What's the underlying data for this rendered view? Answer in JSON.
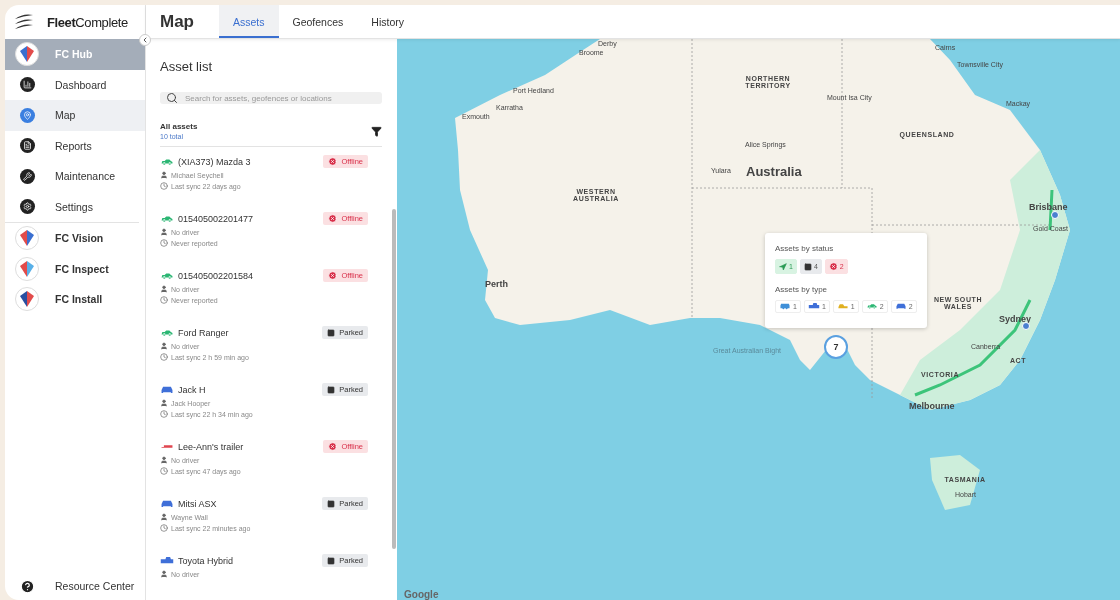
{
  "brand": {
    "name_bold": "Fleet",
    "name_rest": "Complete"
  },
  "sidebar": {
    "items": [
      {
        "kind": "app",
        "label": "FC Hub",
        "selected": true
      },
      {
        "kind": "nav",
        "label": "Dashboard",
        "selected": false
      },
      {
        "kind": "nav",
        "label": "Map",
        "selected": true
      },
      {
        "kind": "nav",
        "label": "Reports",
        "selected": false
      },
      {
        "kind": "nav",
        "label": "Maintenance",
        "selected": false
      },
      {
        "kind": "nav",
        "label": "Settings",
        "selected": false
      },
      {
        "kind": "app",
        "label": "FC Vision",
        "selected": false
      },
      {
        "kind": "app",
        "label": "FC Inspect",
        "selected": false
      },
      {
        "kind": "app",
        "label": "FC Install",
        "selected": false
      }
    ],
    "footer": "Resource Center"
  },
  "header": {
    "title": "Map",
    "tabs": [
      {
        "label": "Assets",
        "selected": true
      },
      {
        "label": "Geofences",
        "selected": false
      },
      {
        "label": "History",
        "selected": false
      }
    ]
  },
  "asset_list": {
    "title": "Asset list",
    "search": {
      "placeholder": "Search for assets, geofences or locations"
    },
    "group": "All assets",
    "total": "10 total",
    "assets": [
      {
        "name": "(XIA373) Mazda 3",
        "kind": "car",
        "color": "#2bb673",
        "status": {
          "kind": "offline",
          "label": "Offline"
        },
        "driver": "Michael Seychell",
        "sync": "Last sync 22 days ago"
      },
      {
        "name": "015405002201477",
        "kind": "car",
        "color": "#2bb673",
        "status": {
          "kind": "offline",
          "label": "Offline"
        },
        "driver": "No driver",
        "sync": "Never reported"
      },
      {
        "name": "015405002201584",
        "kind": "car",
        "color": "#2bb673",
        "status": {
          "kind": "offline",
          "label": "Offline"
        },
        "driver": "No driver",
        "sync": "Never reported"
      },
      {
        "name": "Ford Ranger",
        "kind": "car",
        "color": "#2bb673",
        "status": {
          "kind": "parked",
          "label": "Parked"
        },
        "driver": "No driver",
        "sync": "Last sync 2 h 59 min ago"
      },
      {
        "name": "Jack H",
        "kind": "suv",
        "color": "#3f6fd8",
        "status": {
          "kind": "parked",
          "label": "Parked"
        },
        "driver": "Jack Hooper",
        "sync": "Last sync 22 h 34 min ago"
      },
      {
        "name": "Lee-Ann's trailer",
        "kind": "trailer",
        "color": "#e0454f",
        "status": {
          "kind": "offline",
          "label": "Offline"
        },
        "driver": "No driver",
        "sync": "Last sync 47 days ago"
      },
      {
        "name": "Mitsi ASX",
        "kind": "suv",
        "color": "#3f6fd8",
        "status": {
          "kind": "parked",
          "label": "Parked"
        },
        "driver": "Wayne Wall",
        "sync": "Last sync 22 minutes ago"
      },
      {
        "name": "Toyota Hybrid",
        "kind": "pickup",
        "color": "#3f6fd8",
        "status": {
          "kind": "parked",
          "label": "Parked"
        },
        "driver": "No driver"
      }
    ]
  },
  "map": {
    "labels": [
      {
        "text": "Derby",
        "kind": "city"
      },
      {
        "text": "Broome",
        "kind": "city"
      },
      {
        "text": "Port Hedland",
        "kind": "city"
      },
      {
        "text": "Karratha",
        "kind": "city"
      },
      {
        "text": "Exmouth",
        "kind": "city"
      },
      {
        "text": "Cairns",
        "kind": "city"
      },
      {
        "text": "Townsville City",
        "kind": "city"
      },
      {
        "text": "Mackay",
        "kind": "city"
      },
      {
        "text": "NORTHERN TERRITORY",
        "kind": "region"
      },
      {
        "text": "Mount Isa City",
        "kind": "city"
      },
      {
        "text": "Alice Springs",
        "kind": "city"
      },
      {
        "text": "Yulara",
        "kind": "city"
      },
      {
        "text": "Australia",
        "kind": "country"
      },
      {
        "text": "QUEENSLAND",
        "kind": "region"
      },
      {
        "text": "WESTERN AUSTRALIA",
        "kind": "region"
      },
      {
        "text": "Perth",
        "kind": "major"
      },
      {
        "text": "Brisbane",
        "kind": "major"
      },
      {
        "text": "Gold Coast",
        "kind": "city"
      },
      {
        "text": "NEW SOUTH WALES",
        "kind": "region"
      },
      {
        "text": "Sydney",
        "kind": "major"
      },
      {
        "text": "Canberra",
        "kind": "city"
      },
      {
        "text": "ACT",
        "kind": "region"
      },
      {
        "text": "VICTORIA",
        "kind": "region"
      },
      {
        "text": "Melbourne",
        "kind": "major"
      },
      {
        "text": "TASMANIA",
        "kind": "region"
      },
      {
        "text": "Hobart",
        "kind": "city"
      },
      {
        "text": "Great Australian Bight",
        "kind": "water"
      }
    ],
    "cluster": "7",
    "popup": {
      "status_title": "Assets by status",
      "status": [
        {
          "kind": "moving",
          "count": "1"
        },
        {
          "kind": "parked",
          "count": "4"
        },
        {
          "kind": "offline",
          "count": "2"
        }
      ],
      "type_title": "Assets by type",
      "types": [
        {
          "kind": "van",
          "count": "1",
          "color": "#3f8fd8"
        },
        {
          "kind": "pickup",
          "count": "1",
          "color": "#3f6fd8"
        },
        {
          "kind": "loader",
          "count": "1",
          "color": "#e0b020"
        },
        {
          "kind": "car",
          "count": "2",
          "color": "#2bb673"
        },
        {
          "kind": "suv",
          "count": "2",
          "color": "#3f6fd8"
        }
      ]
    },
    "attribution": "Google"
  }
}
